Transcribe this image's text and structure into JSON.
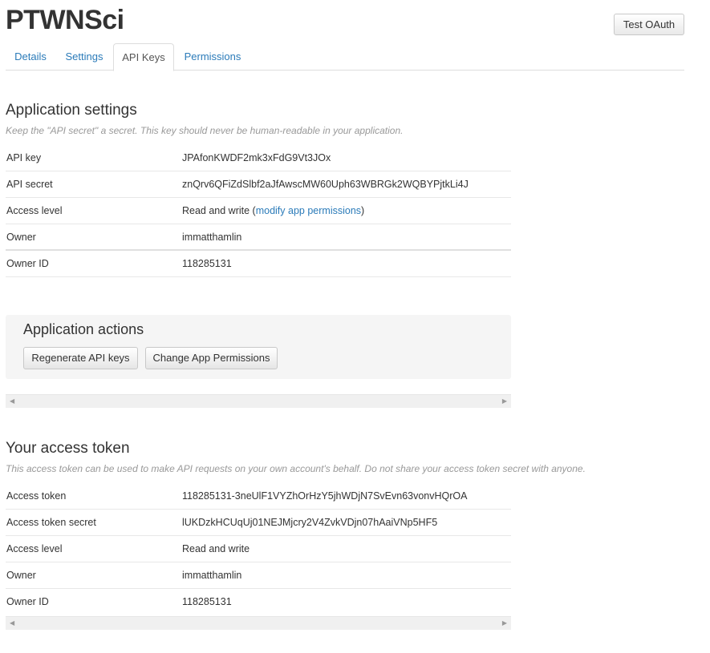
{
  "app": {
    "title": "PTWNSci",
    "test_oauth_label": "Test OAuth"
  },
  "tabs": [
    {
      "label": "Details"
    },
    {
      "label": "Settings"
    },
    {
      "label": "API Keys"
    },
    {
      "label": "Permissions"
    }
  ],
  "app_settings": {
    "title": "Application settings",
    "description": "Keep the \"API secret\" a secret. This key should never be human-readable in your application.",
    "rows": [
      {
        "key": "API key",
        "value": "JPAfonKWDF2mk3xFdG9Vt3JOx"
      },
      {
        "key": "API secret",
        "value": "znQrv6QFiZdSlbf2aJfAwscMW60Uph63WBRGk2WQBYPjtkLi4J"
      },
      {
        "key": "Access level",
        "value": "Read and write (",
        "link": "modify app permissions",
        "suffix": ")"
      },
      {
        "key": "Owner",
        "value": "immatthamlin"
      },
      {
        "key": "Owner ID",
        "value": "118285131"
      }
    ]
  },
  "app_actions": {
    "title": "Application actions",
    "regenerate_label": "Regenerate API keys",
    "change_perms_label": "Change App Permissions"
  },
  "access_token": {
    "title": "Your access token",
    "description": "This access token can be used to make API requests on your own account's behalf. Do not share your access token secret with anyone.",
    "rows": [
      {
        "key": "Access token",
        "value": "118285131-3neUlF1VYZhOrHzY5jhWDjN7SvEvn63vonvHQrOA"
      },
      {
        "key": "Access token secret",
        "value": "lUKDzkHCUqUj01NEJMjcry2V4ZvkVDjn07hAaiVNp5HF5"
      },
      {
        "key": "Access level",
        "value": "Read and write"
      },
      {
        "key": "Owner",
        "value": "immatthamlin"
      },
      {
        "key": "Owner ID",
        "value": "118285131"
      }
    ]
  },
  "scroll_arrows": {
    "left": "◀",
    "right": "▶"
  }
}
